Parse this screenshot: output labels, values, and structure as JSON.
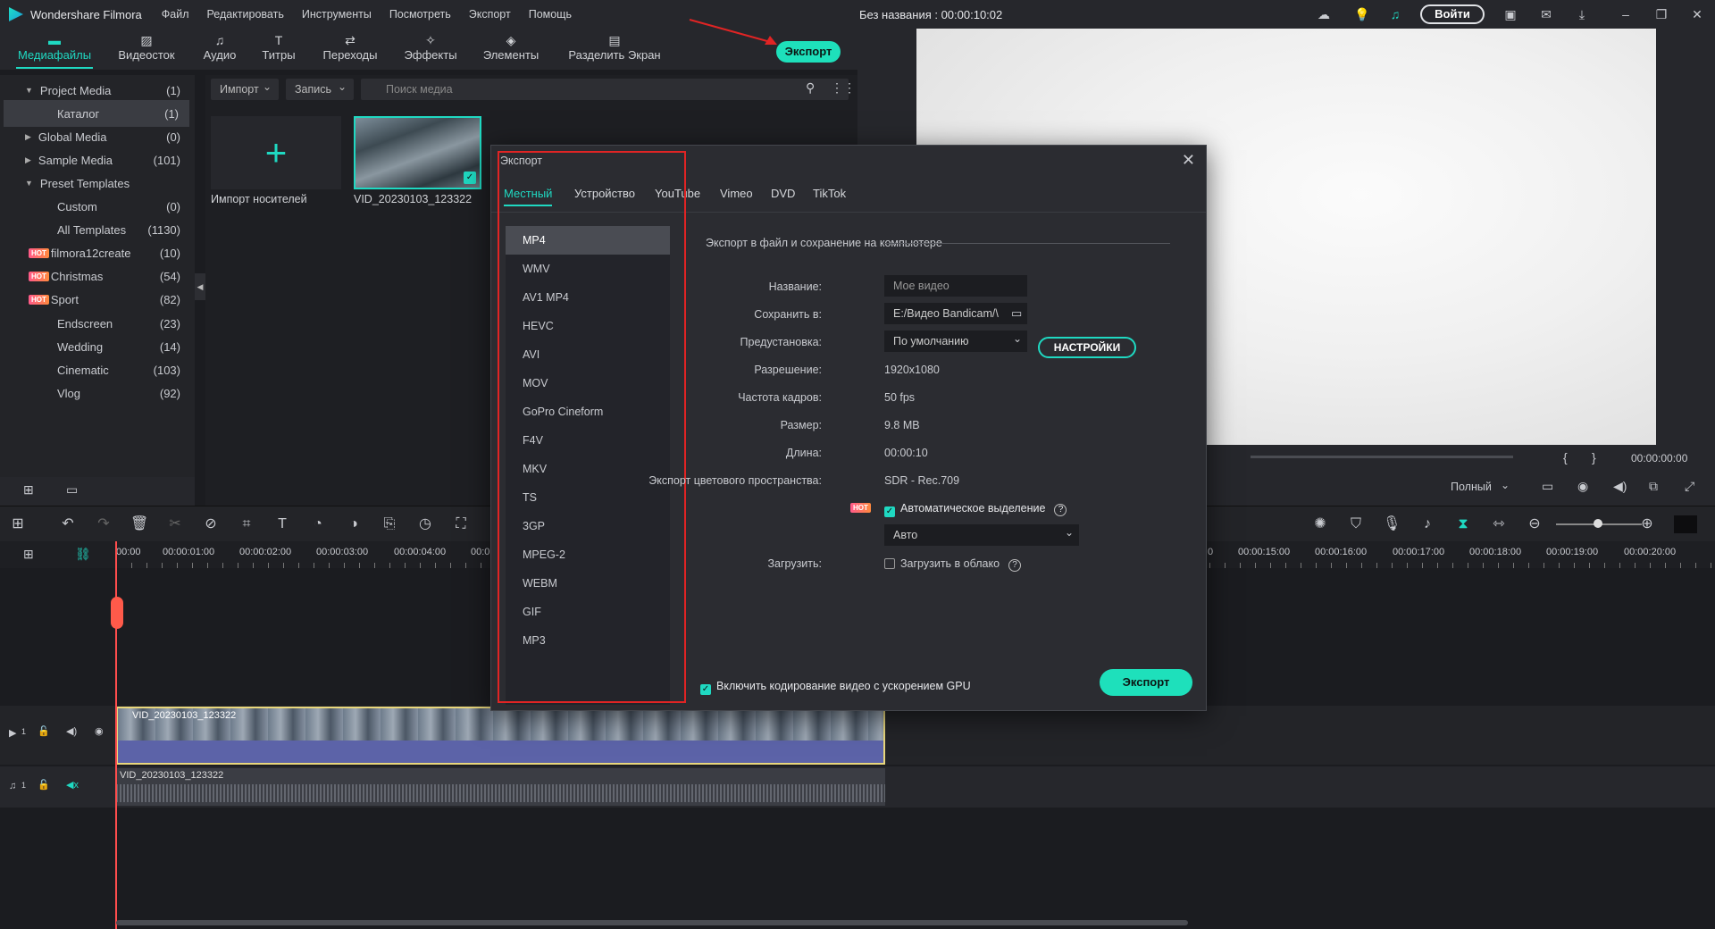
{
  "app": {
    "name": "Wondershare Filmora",
    "menu": [
      "Файл",
      "Редактировать",
      "Инструменты",
      "Посмотреть",
      "Экспорт",
      "Помощь"
    ],
    "doc_title": "Без названия : 00:00:10:02",
    "login": "Войти",
    "export_button": "Экспорт"
  },
  "toolbar_tabs": [
    {
      "label": "Медиафайлы",
      "icon": "folder-icon"
    },
    {
      "label": "Видеосток",
      "icon": "image-icon"
    },
    {
      "label": "Аудио",
      "icon": "music-icon"
    },
    {
      "label": "Титры",
      "icon": "text-icon"
    },
    {
      "label": "Переходы",
      "icon": "transition-icon"
    },
    {
      "label": "Эффекты",
      "icon": "effects-icon"
    },
    {
      "label": "Элементы",
      "icon": "elements-icon"
    },
    {
      "label": "Разделить Экран",
      "icon": "splitscreen-icon"
    }
  ],
  "sidebar": {
    "items": [
      {
        "label": "Project Media",
        "count": "(1)",
        "tri": "▼",
        "indent": 0,
        "hot": false
      },
      {
        "label": "Каталог",
        "count": "(1)",
        "tri": "",
        "indent": 2,
        "hot": false
      },
      {
        "label": "Global Media",
        "count": "(0)",
        "tri": "▶",
        "indent": 0,
        "hot": false
      },
      {
        "label": "Sample Media",
        "count": "(101)",
        "tri": "▶",
        "indent": 0,
        "hot": false
      },
      {
        "label": "Preset Templates",
        "count": "",
        "tri": "▼",
        "indent": 0,
        "hot": false
      },
      {
        "label": "Custom",
        "count": "(0)",
        "tri": "",
        "indent": 2,
        "hot": false
      },
      {
        "label": "All Templates",
        "count": "(1130)",
        "tri": "",
        "indent": 2,
        "hot": false
      },
      {
        "label": "filmora12create",
        "count": "(10)",
        "tri": "",
        "indent": 1,
        "hot": true
      },
      {
        "label": "Christmas",
        "count": "(54)",
        "tri": "",
        "indent": 1,
        "hot": true
      },
      {
        "label": "Sport",
        "count": "(82)",
        "tri": "",
        "indent": 1,
        "hot": true
      },
      {
        "label": "Endscreen",
        "count": "(23)",
        "tri": "",
        "indent": 2,
        "hot": false
      },
      {
        "label": "Wedding",
        "count": "(14)",
        "tri": "",
        "indent": 2,
        "hot": false
      },
      {
        "label": "Cinematic",
        "count": "(103)",
        "tri": "",
        "indent": 2,
        "hot": false
      },
      {
        "label": "Vlog",
        "count": "(92)",
        "tri": "",
        "indent": 2,
        "hot": false
      }
    ],
    "hot_badge": "HOT"
  },
  "media": {
    "import_dropdown": "Импорт",
    "record_dropdown": "Запись",
    "search_placeholder": "Поиск медиа",
    "import_label": "Импорт носителей",
    "clip_label": "VID_20230103_123322"
  },
  "preview": {
    "timecode": "00:00:00:00",
    "quality": "Полный"
  },
  "timeline": {
    "ruler_left": [
      "00:00",
      "00:00:01:00",
      "00:00:02:00",
      "00:00:03:00",
      "00:00:04:00",
      "00:0"
    ],
    "ruler_right": [
      "0",
      "00:00:15:00",
      "00:00:16:00",
      "00:00:17:00",
      "00:00:18:00",
      "00:00:19:00",
      "00:00:20:00"
    ],
    "video_clip": "VID_20230103_123322",
    "audio_clip": "VID_20230103_123322",
    "video_track_num": "1",
    "audio_track_num": "1"
  },
  "dialog": {
    "title": "Экспорт",
    "tabs": [
      "Местный",
      "Устройство",
      "YouTube",
      "Vimeo",
      "DVD",
      "TikTok"
    ],
    "formats": [
      "MP4",
      "WMV",
      "AV1 MP4",
      "HEVC",
      "AVI",
      "MOV",
      "GoPro Cineform",
      "F4V",
      "MKV",
      "TS",
      "3GP",
      "MPEG-2",
      "WEBM",
      "GIF",
      "MP3"
    ],
    "section": "Экспорт в файл и сохранение на компьютере",
    "name_label": "Название:",
    "name_placeholder": "Мое видео",
    "save_label": "Сохранить в:",
    "save_value": "E:/Видео Bandicam/\\",
    "preset_label": "Предустановка:",
    "preset_value": "По умолчанию",
    "settings_button": "НАСТРОЙКИ",
    "resolution_label": "Разрешение:",
    "resolution_value": "1920x1080",
    "fps_label": "Частота кадров:",
    "fps_value": "50 fps",
    "size_label": "Размер:",
    "size_value": "9.8 MB",
    "length_label": "Длина:",
    "length_value": "00:00:10",
    "colorspace_label": "Экспорт цветового пространства:",
    "colorspace_value": "SDR - Rec.709",
    "auto_highlight": "Автоматическое выделение",
    "auto_value": "Авто",
    "upload_label": "Загрузить:",
    "upload_cloud": "Загрузить в облако",
    "gpu_label": "Включить кодирование видео с ускорением GPU",
    "export_button": "Экспорт",
    "hot_badge": "HOT"
  },
  "colors": {
    "accent": "#1fd9c2",
    "highlight_box": "#e02424",
    "playhead": "#ff4d4d"
  }
}
